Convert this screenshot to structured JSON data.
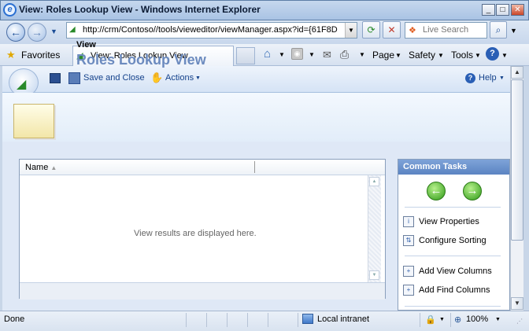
{
  "window": {
    "title": "View: Roles Lookup View - Windows Internet Explorer",
    "icon": "ie-icon"
  },
  "address": {
    "url": "http://crm/Contoso//tools/vieweditor/viewManager.aspx?id={61F8D"
  },
  "search": {
    "placeholder": "Live Search"
  },
  "favorites": {
    "label": "Favorites"
  },
  "tab": {
    "label": "View: Roles Lookup View"
  },
  "commands": {
    "page": "Page",
    "safety": "Safety",
    "tools": "Tools"
  },
  "crm_toolbar": {
    "save_close": "Save and Close",
    "actions": "Actions",
    "help": "Help"
  },
  "header": {
    "label": "View",
    "title": "Roles Lookup View"
  },
  "grid": {
    "column": "Name",
    "empty_text": "View results are displayed here."
  },
  "tasks": {
    "title": "Common Tasks",
    "items": [
      "View Properties",
      "Configure Sorting",
      "Add View Columns",
      "Add Find Columns"
    ]
  },
  "status": {
    "left": "Done",
    "zone": "Local intranet",
    "zoom": "100%"
  }
}
